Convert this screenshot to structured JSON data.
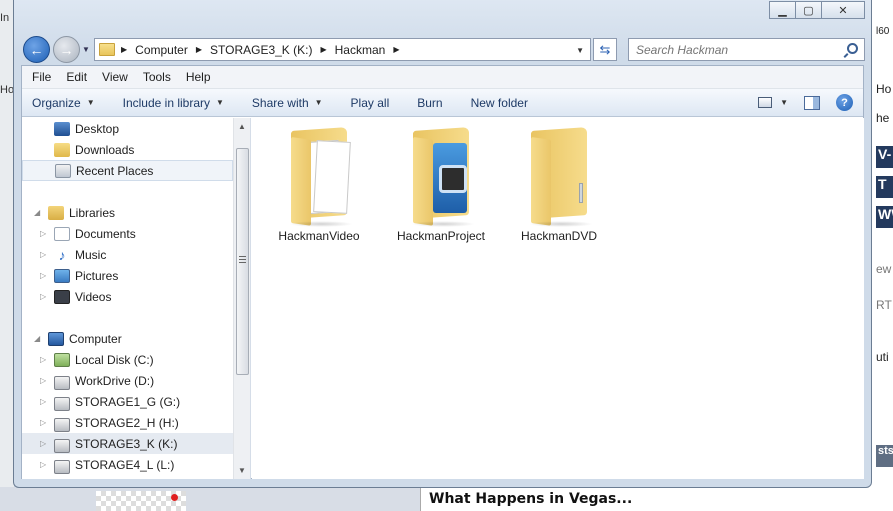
{
  "window": {
    "caption_buttons": [
      "minimize",
      "maximize",
      "close"
    ]
  },
  "address_bar": {
    "crumbs": [
      "Computer",
      "STORAGE3_K (K:)",
      "Hackman"
    ]
  },
  "search": {
    "placeholder": "Search Hackman"
  },
  "menu": {
    "items": [
      "File",
      "Edit",
      "View",
      "Tools",
      "Help"
    ]
  },
  "commands": {
    "organize": "Organize",
    "include": "Include in library",
    "share": "Share with",
    "play_all": "Play all",
    "burn": "Burn",
    "new_folder": "New folder"
  },
  "nav": {
    "favorites": [
      {
        "label": "Desktop",
        "icon": "desktop-icon"
      },
      {
        "label": "Downloads",
        "icon": "downloads-folder-icon"
      },
      {
        "label": "Recent Places",
        "icon": "recent-places-icon"
      }
    ],
    "libraries": {
      "label": "Libraries",
      "items": [
        {
          "label": "Documents",
          "icon": "documents-icon"
        },
        {
          "label": "Music",
          "icon": "music-icon"
        },
        {
          "label": "Pictures",
          "icon": "pictures-icon"
        },
        {
          "label": "Videos",
          "icon": "videos-icon"
        }
      ]
    },
    "computer": {
      "label": "Computer",
      "items": [
        {
          "label": "Local Disk (C:)",
          "icon": "local-disk-icon"
        },
        {
          "label": "WorkDrive (D:)",
          "icon": "drive-icon"
        },
        {
          "label": "STORAGE1_G (G:)",
          "icon": "drive-icon"
        },
        {
          "label": "STORAGE2_H (H:)",
          "icon": "drive-icon"
        },
        {
          "label": "STORAGE3_K (K:)",
          "icon": "drive-icon",
          "selected": true
        },
        {
          "label": "STORAGE4_L (L:)",
          "icon": "drive-icon"
        }
      ]
    }
  },
  "files": [
    {
      "name": "HackmanVideo",
      "icon": "folder-with-documents-icon"
    },
    {
      "name": "HackmanProject",
      "icon": "folder-with-project-icon"
    },
    {
      "name": "HackmanDVD",
      "icon": "empty-folder-icon"
    }
  ],
  "background": {
    "left_fragments": [
      "In",
      "Ho"
    ],
    "right_fragments": [
      "l60",
      "Ho",
      "he l",
      "V-",
      "T",
      "WW",
      "ew",
      "RT",
      "uti",
      "sts"
    ],
    "news_title": "What Happens in Vegas..."
  },
  "colors": {
    "accent": "#1d5fb5",
    "command_text": "#1e3a66",
    "folder": "#f6dc8c"
  }
}
